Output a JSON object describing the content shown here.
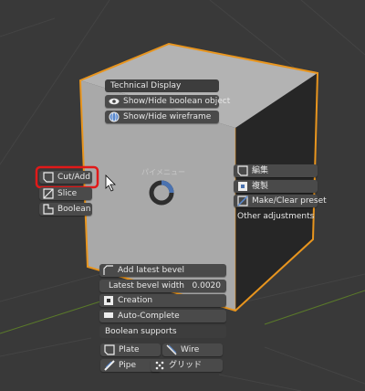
{
  "viewport_label": "パイメニュー",
  "top_menu": {
    "header": "Technical Display",
    "items": [
      {
        "label": "Show/Hide boolean object",
        "icon": "eye-icon"
      },
      {
        "label": "Show/Hide wireframe",
        "icon": "wireframe-sphere-icon"
      }
    ]
  },
  "left_menu": {
    "items": [
      {
        "label": "Cut/Add",
        "icon": "cut-add-icon",
        "selected": true
      },
      {
        "label": "Slice",
        "icon": "slice-icon"
      },
      {
        "label": "Boolean",
        "icon": "boolean-icon"
      }
    ]
  },
  "right_menu": {
    "items": [
      {
        "label": "編集",
        "icon": "edit-icon"
      },
      {
        "label": "複製",
        "icon": "duplicate-icon"
      },
      {
        "label": "Make/Clear preset",
        "icon": "preset-icon"
      }
    ],
    "footer": "Other adjustments"
  },
  "bottom_menu": {
    "add_bevel": "Add latest bevel",
    "bevel_width_label": "Latest bevel width",
    "bevel_width_value": "0.0020",
    "creation": "Creation",
    "auto_complete": "Auto-Complete",
    "boolean_supports": "Boolean supports",
    "grid_buttons": [
      {
        "label": "Plate",
        "icon": "plate-icon"
      },
      {
        "label": "Wire",
        "icon": "wire-icon"
      },
      {
        "label": "Pipe",
        "icon": "pipe-icon"
      },
      {
        "label": "グリッド",
        "icon": "grid-icon"
      }
    ]
  },
  "colors": {
    "background": "#393939",
    "cube_front": "#a9a9a9",
    "cube_top": "#b3b3b3",
    "cube_side": "#262626",
    "selection_outline": "#e8951e",
    "highlight_red": "#e11919",
    "pie_ring_blue": "#4a72b0"
  }
}
